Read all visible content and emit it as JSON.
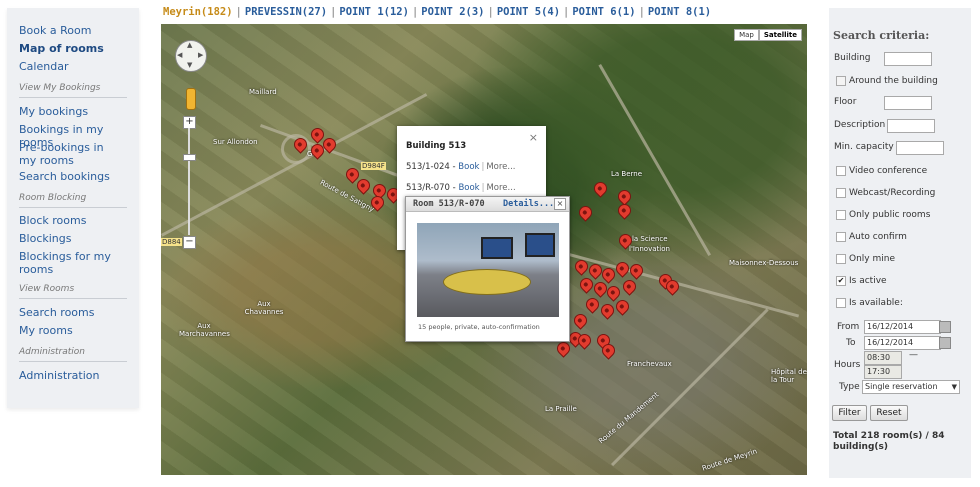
{
  "sidebar": {
    "links_top": [
      "Book a Room",
      "Map of rooms",
      "Calendar"
    ],
    "section_bookings": "View My Bookings",
    "links_bookings": [
      "My bookings",
      "Bookings in my rooms",
      "Pre-bookings in my rooms",
      "Search bookings"
    ],
    "section_blocking": "Room Blocking",
    "links_blocking": [
      "Block rooms",
      "Blockings",
      "Blockings for my rooms"
    ],
    "section_rooms": "View Rooms",
    "links_rooms": [
      "Search rooms",
      "My rooms"
    ],
    "section_admin": "Administration",
    "links_admin": [
      "Administration"
    ]
  },
  "tabs": [
    "Meyrin(182)",
    "PREVESSIN(27)",
    "POINT 1(12)",
    "POINT 2(3)",
    "POINT 5(4)",
    "POINT 6(1)",
    "POINT 8(1)"
  ],
  "map": {
    "type_buttons": [
      "Map",
      "Satellite"
    ],
    "labels": [
      "Golf",
      "Sur Allondon",
      "Maillard",
      "Aux Marchavannes",
      "Aux Chavannes",
      "La Berne",
      "Maisonnex-Dessous",
      "Franchevaux",
      "Hôpital de la Tour",
      "La Praille",
      "Route du Mandement",
      "Route de Meyrin",
      "de la Science",
      "l'Innovation",
      "D984F",
      "D884",
      "Route de Satigny"
    ],
    "zoom_plus": "+",
    "zoom_minus": "−",
    "pan_arrows": [
      "▲",
      "◀",
      "▶",
      "▼"
    ]
  },
  "info_building": {
    "title": "Building 513",
    "close": "×",
    "rows": [
      {
        "room": "513/1-024",
        "book": "Book",
        "more": "More..."
      },
      {
        "room": "513/R-070",
        "book": "Book",
        "more": "More..."
      }
    ],
    "dash": " - ",
    "bar": "|"
  },
  "info_room": {
    "name": "Room 513/R-070",
    "details": "Details...",
    "close": "×",
    "caption": "15 people, private, auto-confirmation"
  },
  "search": {
    "title": "Search criteria:",
    "building_label": "Building",
    "around_label": "Around the building",
    "floor_label": "Floor",
    "description_label": "Description",
    "capacity_label": "Min. capacity",
    "checkboxes": [
      {
        "label": "Video conference",
        "checked": false
      },
      {
        "label": "Webcast/Recording",
        "checked": false
      },
      {
        "label": "Only public rooms",
        "checked": false
      },
      {
        "label": "Auto confirm",
        "checked": false
      },
      {
        "label": "Only mine",
        "checked": false
      },
      {
        "label": "Is active",
        "checked": true
      },
      {
        "label": "Is available:",
        "checked": false
      }
    ],
    "from_label": "From",
    "from_value": "16/12/2014",
    "to_label": "To",
    "to_value": "16/12/2014",
    "hours_label": "Hours",
    "hour_start": "08:30",
    "hour_end": "17:30",
    "hour_dash": "—",
    "type_label": "Type",
    "type_value": "Single reservation",
    "filter_button": "Filter",
    "reset_button": "Reset",
    "total": "Total 218 room(s) / 84 building(s)"
  },
  "colors": {
    "link": "#2a5d9b",
    "active_tab": "#c68b19",
    "pin": "#e23b2e"
  }
}
